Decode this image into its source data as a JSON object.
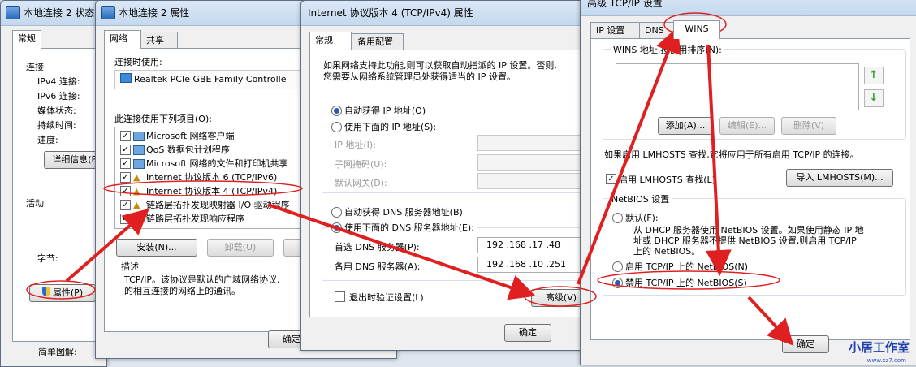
{
  "windows": {
    "status": {
      "title": "本地连接 2 状态",
      "tab_general": "常规",
      "connection_label": "连接",
      "ipv4_label": "IPv4 连接:",
      "ipv6_label": "IPv6 连接:",
      "media_label": "媒体状态:",
      "duration_label": "持续时间:",
      "speed_label": "速度:",
      "details_button": "详细信息(E)",
      "activity_label": "活动",
      "bytes_label": "字节:",
      "properties_button": "属性(P)",
      "bottom_text": "简单图解:"
    },
    "properties": {
      "title": "本地连接 2 属性",
      "tab_network": "网络",
      "tab_sharing": "共享",
      "connect_using_label": "连接时使用:",
      "adapter_name": "Realtek PCIe GBE Family Controlle",
      "items_label": "此连接使用下列项目(O):",
      "items": [
        {
          "label": "Microsoft 网络客户端",
          "checked": true
        },
        {
          "label": "QoS 数据包计划程序",
          "checked": true
        },
        {
          "label": "Microsoft 网络的文件和打印机共享",
          "checked": true
        },
        {
          "label": "Internet 协议版本 6 (TCP/IPv6)",
          "checked": true
        },
        {
          "label": "Internet 协议版本 4 (TCP/IPv4)",
          "checked": true
        },
        {
          "label": "链路层拓扑发现映射器 I/O 驱动程序",
          "checked": true
        },
        {
          "label": "链路层拓扑发现响应程序",
          "checked": true
        }
      ],
      "install_button": "安装(N)...",
      "uninstall_button": "卸载(U)",
      "desc_label": "描述",
      "desc_line1": "TCP/IP。该协议是默认的广域网络协议,",
      "desc_line2": "的相互连接的网络上的通讯。",
      "ok_button": "确定"
    },
    "ipv4": {
      "title": "Internet 协议版本 4 (TCP/IPv4) 属性",
      "tab_general": "常规",
      "tab_alt": "备用配置",
      "intro_line1": "如果网络支持此功能,则可以获取自动指派的 IP 设置。否则,",
      "intro_line2": "您需要从网络系统管理员处获得适当的 IP 设置。",
      "auto_ip": "自动获得 IP 地址(O)",
      "manual_ip": "使用下面的 IP 地址(S):",
      "ip_label": "IP 地址(I):",
      "mask_label": "子网掩码(U):",
      "gateway_label": "默认网关(D):",
      "auto_dns": "自动获得 DNS 服务器地址(B)",
      "manual_dns": "使用下面的 DNS 服务器地址(E):",
      "pref_dns_label": "首选 DNS 服务器(P):",
      "pref_dns_value": "192 .168 .17 .48",
      "alt_dns_label": "备用 DNS 服务器(A):",
      "alt_dns_value": "192 .168 .10 .251",
      "validate_label": "退出时验证设置(L)",
      "advanced_button": "高级(V)",
      "ok_button": "确定"
    },
    "advanced": {
      "title": "高级 TCP/IP 设置",
      "tab_ip": "IP 设置",
      "tab_dns": "DNS",
      "tab_wins": "WINS",
      "wins_list_label": "WINS 地址,按使用排序(N):",
      "add_button": "添加(A)...",
      "edit_button": "编辑(E)...",
      "delete_button": "删除(V)",
      "lmhosts_text": "如果启用 LMHOSTS 查找,它将应用于所有启用 TCP/IP 的连接。",
      "lmhosts_check": "启用 LMHOSTS 查找(L)",
      "import_button": "导入 LMHOSTS(M)...",
      "netbios_group": "NetBIOS 设置",
      "default_radio": "默认(F):",
      "default_desc1": "从 DHCP 服务器使用 NetBIOS 设置。如果使用静态 IP 地",
      "default_desc2": "址或 DHCP 服务器不提供 NetBIOS 设置,则启用 TCP/IP",
      "default_desc3": "上的 NetBIOS。",
      "enable_radio": "启用 TCP/IP 上的 NetBIOS(N)",
      "disable_radio": "禁用 TCP/IP 上的 NetBIOS(S)",
      "ok_button": "确定"
    }
  },
  "watermark": {
    "text": "小居工作室",
    "url": "www.xz7.com"
  },
  "colors": {
    "annotation_red": "#e02020",
    "selection_blue": "#2a5cae"
  }
}
